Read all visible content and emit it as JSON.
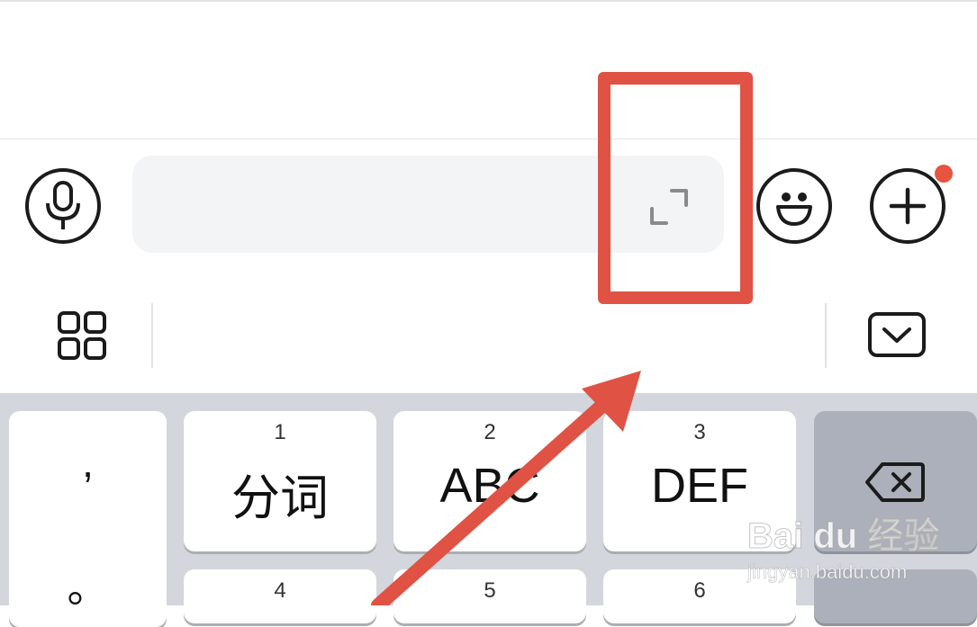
{
  "input_bar": {
    "voice_icon": "microphone-icon",
    "expand_icon": "expand-corners-icon",
    "emoji_icon": "smiley-face-icon",
    "more_icon": "plus-circle-icon",
    "badge_color": "#e7543f"
  },
  "toolbar": {
    "menu_icon": "grid-four-squares-icon",
    "collapse_icon": "keyboard-collapse-icon"
  },
  "keyboard": {
    "punctuation": [
      ",",
      "。"
    ],
    "keys": [
      {
        "num": "1",
        "label": "分词"
      },
      {
        "num": "2",
        "label": "ABC"
      },
      {
        "num": "3",
        "label": "DEF"
      },
      {
        "num": "4",
        "label": ""
      },
      {
        "num": "5",
        "label": ""
      },
      {
        "num": "6",
        "label": ""
      }
    ],
    "backspace_icon": "backspace-icon"
  },
  "annotation": {
    "highlight_color": "#e05244"
  },
  "watermark": {
    "brand": "Bai du 经验",
    "url": "jingyan.baidu.com"
  }
}
